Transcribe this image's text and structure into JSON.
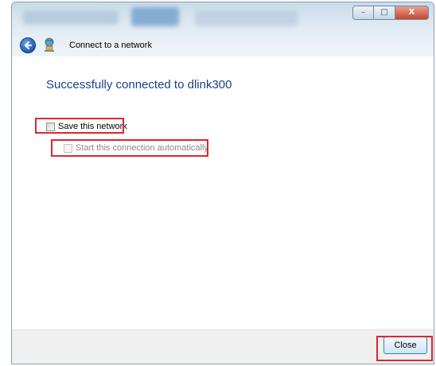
{
  "window": {
    "controls": {
      "minimize": "–",
      "maximize": "□",
      "close": "X"
    }
  },
  "header": {
    "title": "Connect to a network"
  },
  "main": {
    "success_message": "Successfully connected to dlink300",
    "save_network_label": "Save this network",
    "start_auto_label": "Start this connection automatically"
  },
  "footer": {
    "close_label": "Close"
  },
  "colors": {
    "highlight": "#e0262b",
    "heading": "#1e3f8a"
  }
}
